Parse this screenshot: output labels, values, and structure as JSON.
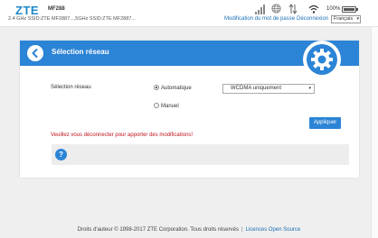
{
  "header": {
    "brand": "ZTE",
    "model": "MF288",
    "ssid_line": "2.4 GHz SSID:ZTE MF2887...,5GHz SSID:ZTE MF2887...",
    "battery_text": "100%",
    "battery_level": 1.0,
    "change_password_label": "Modification du mot de passe",
    "logout_label": "Déconnexion",
    "language": "Français"
  },
  "page": {
    "title": "Sélection réseau",
    "field_label": "Sélection réseau",
    "options": {
      "auto_label": "Automatique",
      "manual_label": "Manuel",
      "selected": "Automatique"
    },
    "mode_value": "WCDMA uniquement",
    "apply_label": "Appliquer",
    "warning": "Veuillez vous déconnecter pour apporter des modifications!",
    "help_glyph": "?"
  },
  "footer": {
    "copyright": "Droits d'auteur © 1998-2017 ZTE Corporation. Tous droits réservés",
    "separator": "|",
    "licence_label": "Licences Open Source"
  },
  "icons": {
    "signal": "signal-bars-icon",
    "globe": "globe-icon",
    "data": "data-transfer-icon",
    "wifi": "wifi-icon",
    "battery": "battery-icon",
    "back": "back-arrow-icon",
    "gear": "gear-icon",
    "help": "help-icon"
  },
  "colors": {
    "accent": "#2b84d6",
    "brand": "#1e88c8",
    "link": "#1a6fb5",
    "warning": "#c0141e"
  }
}
